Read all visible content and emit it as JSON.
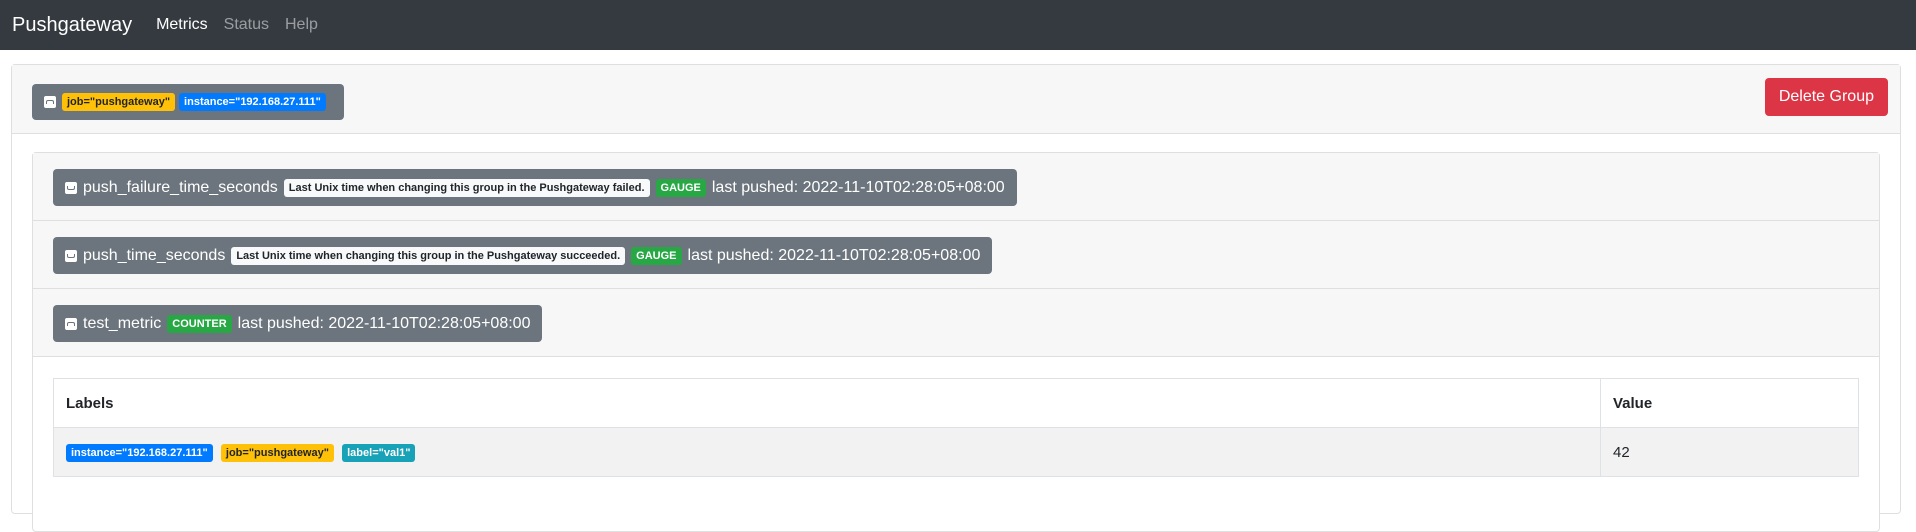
{
  "navbar": {
    "brand": "Pushgateway",
    "links": [
      {
        "label": "Metrics",
        "active": true
      },
      {
        "label": "Status",
        "active": false
      },
      {
        "label": "Help",
        "active": false
      }
    ]
  },
  "group": {
    "labels": [
      "job=\"pushgateway\"",
      "instance=\"192.168.27.111\""
    ],
    "delete_label": "Delete Group"
  },
  "metrics": [
    {
      "name": "push_failure_time_seconds",
      "help": "Last Unix time when changing this group in the Pushgateway failed.",
      "type": "GAUGE",
      "last_pushed": "last pushed: 2022-11-10T02:28:05+08:00"
    },
    {
      "name": "push_time_seconds",
      "help": "Last Unix time when changing this group in the Pushgateway succeeded.",
      "type": "GAUGE",
      "last_pushed": "last pushed: 2022-11-10T02:28:05+08:00"
    },
    {
      "name": "test_metric",
      "type": "COUNTER",
      "last_pushed": "last pushed: 2022-11-10T02:28:05+08:00"
    }
  ],
  "table": {
    "headers": [
      "Labels",
      "Value"
    ],
    "rows": [
      {
        "labels": [
          "instance=\"192.168.27.111\"",
          "job=\"pushgateway\"",
          "label=\"val1\""
        ],
        "value": "42"
      }
    ]
  },
  "colors": {
    "navbar": "#343a40",
    "danger": "#dc3545",
    "warning": "#ffc107",
    "primary": "#007bff",
    "info": "#17a2b8",
    "success": "#28a745",
    "secondary": "#6c757d"
  }
}
